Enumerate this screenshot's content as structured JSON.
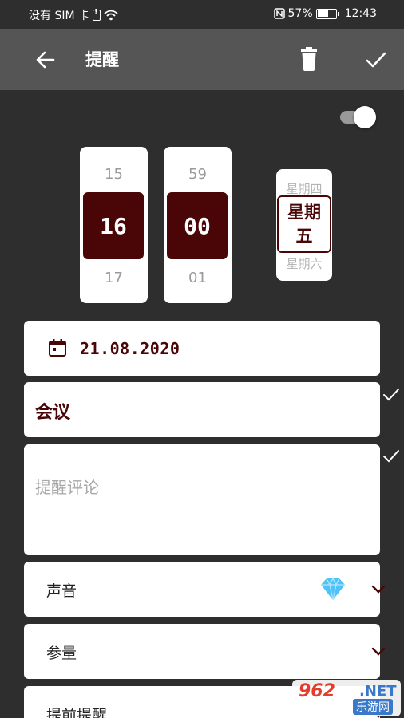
{
  "status_bar": {
    "carrier": "没有 SIM 卡",
    "battery": "57%",
    "time": "12:43",
    "icons": [
      "sim-alert-icon",
      "wifi-icon",
      "nfc-icon",
      "battery-charging-icon"
    ]
  },
  "toolbar": {
    "title": "提醒",
    "back_icon": "arrow-left-icon",
    "delete_icon": "trash-icon",
    "save_icon": "check-icon"
  },
  "enabled_toggle": {
    "state": "on"
  },
  "time_picker": {
    "hour": {
      "prev": "15",
      "selected": "16",
      "next": "17"
    },
    "minute": {
      "prev": "59",
      "selected": "00",
      "next": "01"
    },
    "day": {
      "prev": "星期四",
      "selected_line1": "星期",
      "selected_line2": "五",
      "next": "星期六"
    }
  },
  "date_field": {
    "value": "21.08.2020",
    "icon": "calendar-icon"
  },
  "title_field": {
    "value": "会议"
  },
  "comment_field": {
    "placeholder": "提醒评论",
    "value": ""
  },
  "options": [
    {
      "label": "声音",
      "badge_icon": "diamond-icon"
    },
    {
      "label": "参量"
    },
    {
      "label": "提前提醒"
    }
  ],
  "watermark": {
    "brand": "962",
    "domain": ".NET",
    "site": "乐游网"
  },
  "colors": {
    "accent": "#4a0606",
    "background": "#2e2e2e",
    "toolbar": "#555555",
    "card": "#ffffff",
    "diamond": "#4fc3f7"
  }
}
